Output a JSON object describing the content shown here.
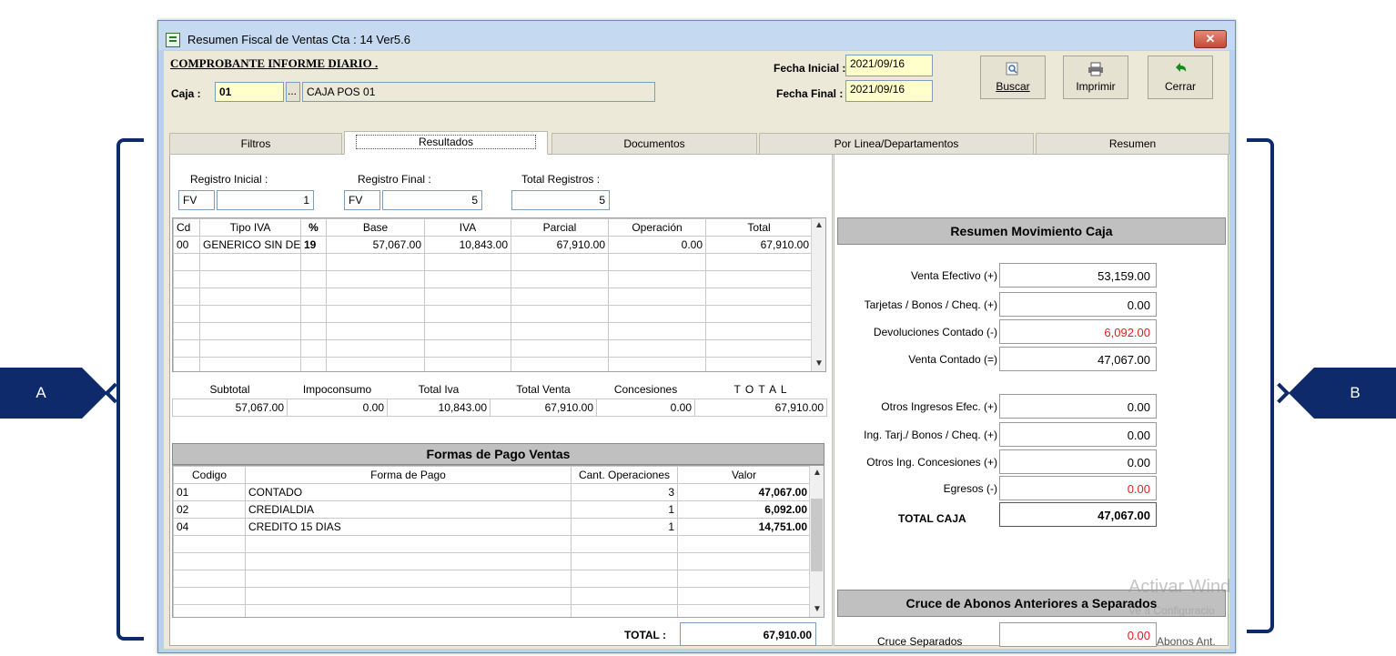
{
  "window": {
    "title": "Resumen Fiscal de Ventas Cta : 14  Ver5.6",
    "close_label": "✕"
  },
  "header": {
    "comprobante": "COMPROBANTE  INFORME DIARIO .",
    "caja_label": "Caja :",
    "caja_code": "01",
    "caja_browse": "...",
    "caja_name": "CAJA POS 01",
    "fecha_inicial_label": "Fecha Inicial :",
    "fecha_inicial": "2021/09/16",
    "fecha_final_label": "Fecha Final :",
    "fecha_final": "2021/09/16"
  },
  "toolbar": {
    "buscar": "Buscar",
    "imprimir": "Imprimir",
    "cerrar": "Cerrar"
  },
  "tabs": [
    "Filtros",
    "Resultados",
    "Documentos",
    "Por Linea/Departamentos",
    "Resumen"
  ],
  "registros": {
    "inicial_label": "Registro Inicial :",
    "final_label": "Registro Final :",
    "total_label": "Total Registros :",
    "inicial_prefix": "FV",
    "inicial_value": "1",
    "final_prefix": "FV",
    "final_value": "5",
    "total_value": "5"
  },
  "iva_table": {
    "headers": [
      "Cd",
      "Tipo IVA",
      "%",
      "Base",
      "IVA",
      "Parcial",
      "Operación",
      "Total"
    ],
    "rows": [
      [
        "00",
        "GENERICO SIN DEF",
        "19",
        "57,067.00",
        "10,843.00",
        "67,910.00",
        "0.00",
        "67,910.00"
      ]
    ]
  },
  "totals": {
    "headers": [
      "Subtotal",
      "Impoconsumo",
      "Total Iva",
      "Total Venta",
      "Concesiones",
      "T O T A L"
    ],
    "values": [
      "57,067.00",
      "0.00",
      "10,843.00",
      "67,910.00",
      "0.00",
      "67,910.00"
    ]
  },
  "pagos": {
    "title": "Formas de Pago Ventas",
    "headers": [
      "Codigo",
      "Forma de Pago",
      "Cant. Operaciones",
      "Valor"
    ],
    "rows": [
      [
        "01",
        "CONTADO",
        "3",
        "47,067.00"
      ],
      [
        "02",
        "CREDIALDIA",
        "1",
        "6,092.00"
      ],
      [
        "04",
        "CREDITO 15 DIAS",
        "1",
        "14,751.00"
      ]
    ],
    "total_label": "TOTAL :",
    "total_value": "67,910.00"
  },
  "resumen_caja": {
    "title": "Resumen Movimiento Caja",
    "items": [
      {
        "label": "Venta Efectivo  (+)",
        "value": "53,159.00",
        "red": false
      },
      {
        "label": "Tarjetas / Bonos / Cheq.  (+)",
        "value": "0.00",
        "red": false
      },
      {
        "label": "Devoluciones Contado   (-)",
        "value": "6,092.00",
        "red": true
      },
      {
        "label": "Venta Contado  (=)",
        "value": "47,067.00",
        "red": false
      },
      {
        "label": "Otros Ingresos Efec.  (+)",
        "value": "0.00",
        "red": false
      },
      {
        "label": "Ing. Tarj./ Bonos / Cheq.  (+)",
        "value": "0.00",
        "red": false
      },
      {
        "label": "Otros Ing. Concesiones  (+)",
        "value": "0.00",
        "red": false
      },
      {
        "label": "Egresos   (-)",
        "value": "0.00",
        "red": true
      }
    ],
    "total_label": "TOTAL CAJA",
    "total_value": "47,067.00"
  },
  "cruce": {
    "title": "Cruce de Abonos Anteriores a Separados",
    "label": "Cruce Separados",
    "value": "0.00",
    "extra": "Abonos Ant."
  },
  "watermark": {
    "line1": "Activar Wind",
    "line2": "Ve a Configuracio"
  },
  "callouts": {
    "a": "A",
    "b": "B"
  },
  "colors": {
    "callout": "#0f2a6b",
    "negative": "#e02020",
    "section_head": "#c0c0c0"
  }
}
